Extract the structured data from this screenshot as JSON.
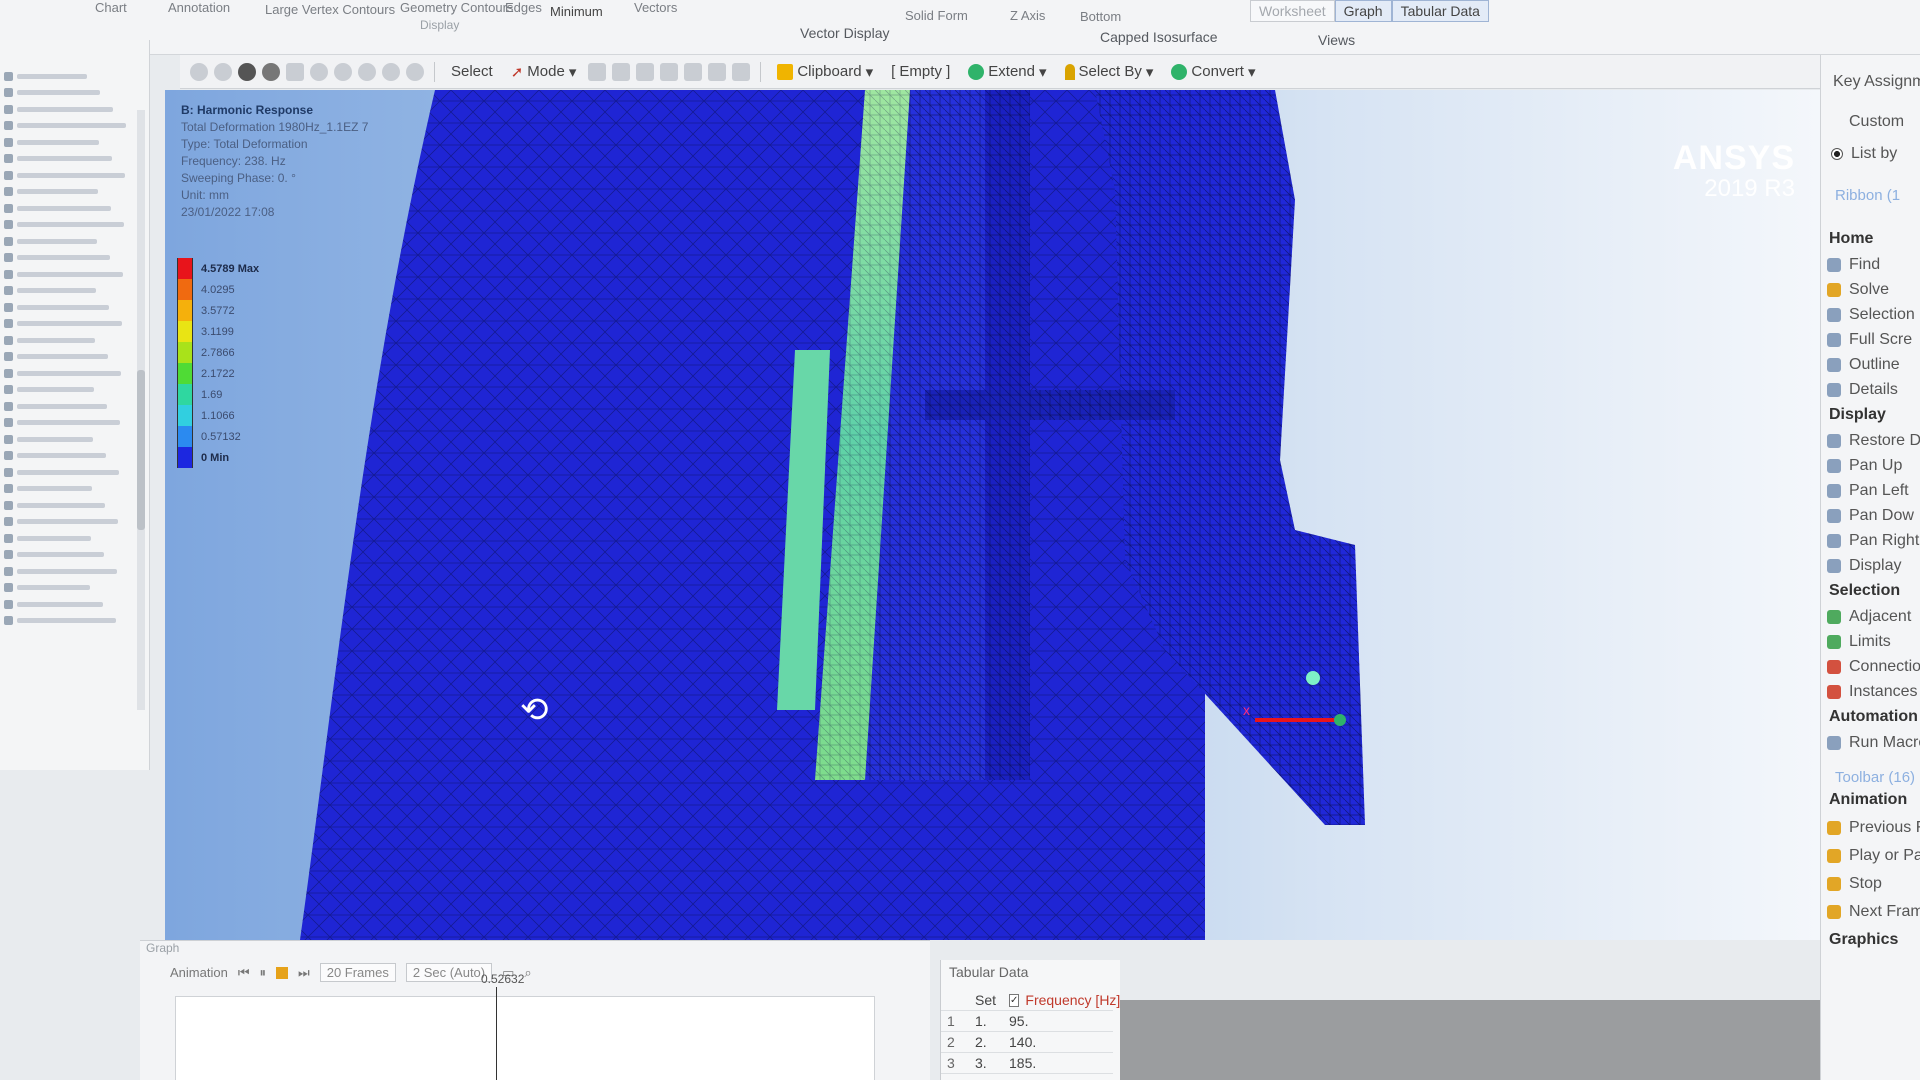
{
  "ribbon": {
    "items": [
      "Chart",
      "Annotation",
      "Large Vertex Contours",
      "Geometry Contours",
      "Edges",
      "Minimum",
      "Vectors",
      "Solid Form",
      "Z Axis",
      "Bottom"
    ],
    "groups": [
      "Display",
      "Vector Display",
      "Capped Isosurface",
      "Views"
    ],
    "views_tabs": [
      "Worksheet",
      "Graph",
      "Tabular Data"
    ]
  },
  "toolbar": {
    "select_label": "Select",
    "mode_label": "Mode",
    "clipboard_label": "Clipboard",
    "empty_label": "[ Empty ]",
    "extend_label": "Extend",
    "select_by_label": "Select By",
    "convert_label": "Convert"
  },
  "viewport": {
    "result_title": "B: Harmonic Response",
    "result_lines": [
      "Total Deformation 1980Hz_1.1EZ 7",
      "Type: Total Deformation",
      "Frequency: 238. Hz",
      "Sweeping Phase: 0. °",
      "Unit: mm",
      "23/01/2022 17:08"
    ],
    "legend": [
      {
        "label": "4.5789 Max",
        "color": "#e8141b",
        "bold": true
      },
      {
        "label": "4.0295",
        "color": "#f06a10",
        "bold": false
      },
      {
        "label": "3.5772",
        "color": "#f5b00c",
        "bold": false
      },
      {
        "label": "3.1199",
        "color": "#e9e414",
        "bold": false
      },
      {
        "label": "2.7866",
        "color": "#a9e21a",
        "bold": false
      },
      {
        "label": "2.1722",
        "color": "#4fdb35",
        "bold": false
      },
      {
        "label": "1.69",
        "color": "#2fd7a0",
        "bold": false
      },
      {
        "label": "1.1066",
        "color": "#31cfe0",
        "bold": false
      },
      {
        "label": "0.57132",
        "color": "#2b8af0",
        "bold": false
      },
      {
        "label": "0 Min",
        "color": "#1c27e0",
        "bold": true
      }
    ],
    "logo_name": "ANSYS",
    "logo_version": "2019 R3"
  },
  "keypanel": {
    "title": "Key Assignm",
    "custom_label": "Custom",
    "list_by_label": "List by",
    "ribbon_label": "Ribbon (1",
    "sections": [
      {
        "head": "Home",
        "items": [
          "Find",
          "Solve",
          "Selection Information",
          "Full Scre",
          "Outline",
          "Details"
        ]
      },
      {
        "head": "Display",
        "items": [
          "Restore D",
          "Pan Up",
          "Pan Left",
          "Pan Dow",
          "Pan Right",
          "Display"
        ]
      },
      {
        "head": "Selection",
        "items": [
          "Adjacent",
          "Limits",
          "Connectio",
          "Instances"
        ]
      },
      {
        "head": "Automation",
        "items": [
          "Run Macro"
        ]
      }
    ],
    "toolbar_label": "Toolbar (16)",
    "animation": {
      "head": "Animation",
      "items": [
        "Previous Fra",
        "Play or Paus",
        "Stop",
        "Next Frame"
      ]
    },
    "graphics_label": "Graphics"
  },
  "graph": {
    "title": "Graph",
    "animation_label": "Animation",
    "frames_value": "20 Frames",
    "duration_value": "2 Sec (Auto)",
    "marker_value": "0.52632"
  },
  "tabular": {
    "title": "Tabular Data",
    "col_set": "Set",
    "col_freq": "Frequency [Hz]",
    "rows": [
      {
        "n": "1",
        "set": "1.",
        "freq": "95."
      },
      {
        "n": "2",
        "set": "2.",
        "freq": "140."
      },
      {
        "n": "3",
        "set": "3.",
        "freq": "185."
      }
    ]
  },
  "colors": {
    "mesh_blue": "#1f25d4",
    "accent_green": "#8ae08a",
    "background_gradient_start": "#7ea6de"
  }
}
